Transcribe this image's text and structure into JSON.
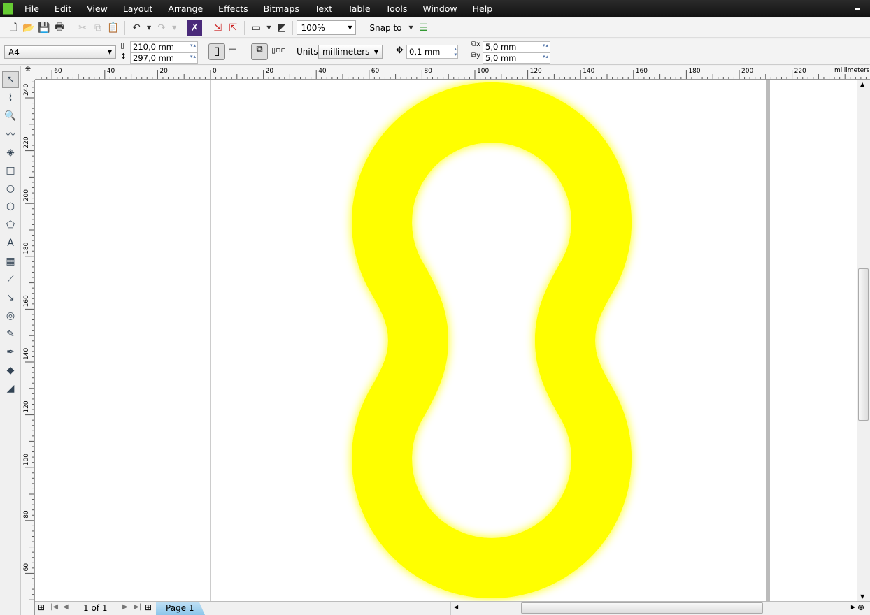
{
  "menu": [
    "File",
    "Edit",
    "View",
    "Layout",
    "Arrange",
    "Effects",
    "Bitmaps",
    "Text",
    "Table",
    "Tools",
    "Window",
    "Help"
  ],
  "toolbar": {
    "zoom": "100%",
    "snap_to": "Snap to"
  },
  "propbar": {
    "page_size": "A4",
    "width": "210,0 mm",
    "height": "297,0 mm",
    "units_label": "Units:",
    "units": "millimeters",
    "nudge": "0,1 mm",
    "dup_x": "5,0 mm",
    "dup_y": "5,0 mm"
  },
  "ruler": {
    "unit": "millimeters",
    "top_labels": [
      "60",
      "40",
      "20",
      "0",
      "20",
      "40",
      "60",
      "80",
      "100",
      "120",
      "140",
      "160",
      "180",
      "200",
      "220"
    ],
    "left_labels": [
      "240",
      "220",
      "200",
      "180",
      "160",
      "140",
      "120",
      "100",
      "80",
      "60"
    ]
  },
  "pager": {
    "count": "1 of 1",
    "tab": "Page 1"
  },
  "colors": {
    "contour_outer": "#FFFF00",
    "contour_inner": "#FF6600"
  }
}
